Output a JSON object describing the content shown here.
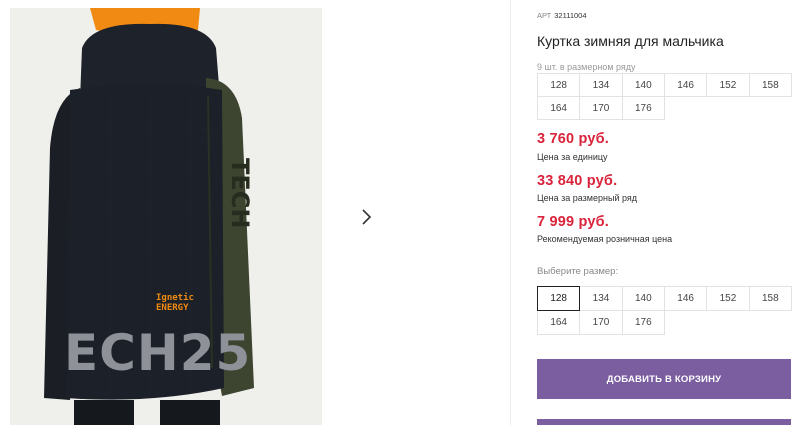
{
  "product": {
    "art_label": "АРТ",
    "art_value": "32111004",
    "title": "Куртка зимняя для мальчика",
    "pack_note": "9 шт. в размерном ряду"
  },
  "pack_sizes": [
    "128",
    "134",
    "140",
    "146",
    "152",
    "158",
    "164",
    "170",
    "176"
  ],
  "prices": [
    {
      "value": "3 760 руб.",
      "label": "Цена за единицу"
    },
    {
      "value": "33 840 руб.",
      "label": "Цена за размерный ряд"
    },
    {
      "value": "7 999 руб.",
      "label": "Рекомендуемая розничная цена"
    }
  ],
  "size_picker": {
    "label": "Выберите размер:",
    "selected": "128",
    "sizes": [
      "128",
      "134",
      "140",
      "146",
      "152",
      "158",
      "164",
      "170",
      "176"
    ]
  },
  "buttons": {
    "add_to_cart": "ДОБАВИТЬ В КОРЗИНУ"
  },
  "photo": {
    "print_line1": "Ignetic",
    "print_line2": "ENERGY",
    "print_big": "ECH25"
  },
  "colors": {
    "price": "#d9243b",
    "accent": "#7a5ea0"
  }
}
